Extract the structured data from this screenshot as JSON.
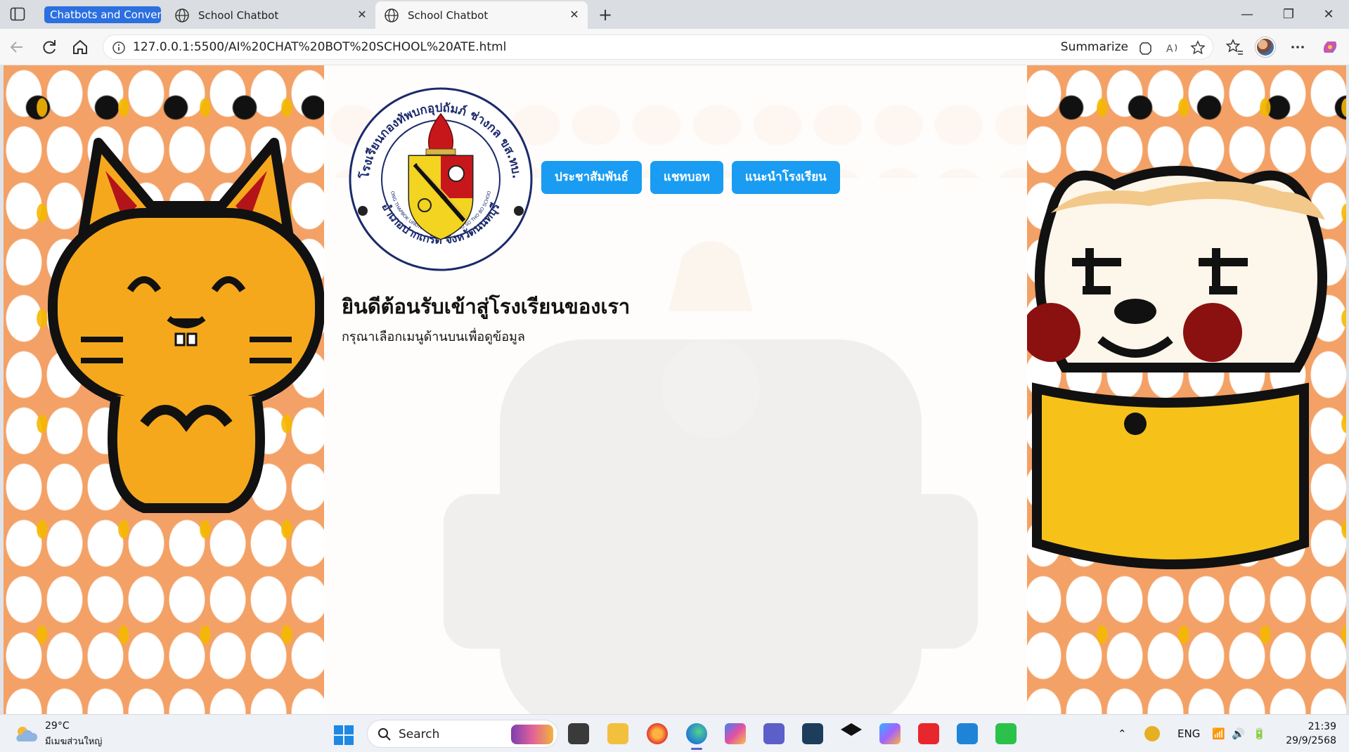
{
  "browser": {
    "tab_group_label": "Chatbots and Convers",
    "tabs": [
      {
        "title": "School Chatbot",
        "active": false
      },
      {
        "title": "School Chatbot",
        "active": true
      }
    ],
    "url": "127.0.0.1:5500/AI%20CHAT%20BOT%20SCHOOL%20ATE.html",
    "summarize_label": "Summarize",
    "accent_color": "#2b6fe0"
  },
  "page": {
    "menu": [
      {
        "label": "ประชาสัมพันธ์"
      },
      {
        "label": "แชทบอท"
      },
      {
        "label": "แนะนำโรงเรียน"
      }
    ],
    "welcome_title": "ยินดีต้อนรับเข้าสู่โรงเรียนของเรา",
    "welcome_subtitle": "กรุณาเลือกเมนูด้านบนเพื่อดูข้อมูล",
    "button_color": "#1a9cf2",
    "logo": {
      "top_arc": "โรงเรียนกองทัพบกอุปถัมภ์ ช่างกล ขส.ทบ.",
      "bottom_arc": "อำเภอปากเกร็ด จังหวัดนนทบุรี",
      "inner_arc": "KONG THAPBOK UPATHAM CHANGKOL KHO SO THO BO SCHOOL"
    }
  },
  "taskbar": {
    "weather_temp": "29°C",
    "weather_location": "มีเมฆส่วนใหญ่",
    "search_label": "Search",
    "language": "ENG",
    "time": "21:39",
    "date": "29/9/2568"
  }
}
